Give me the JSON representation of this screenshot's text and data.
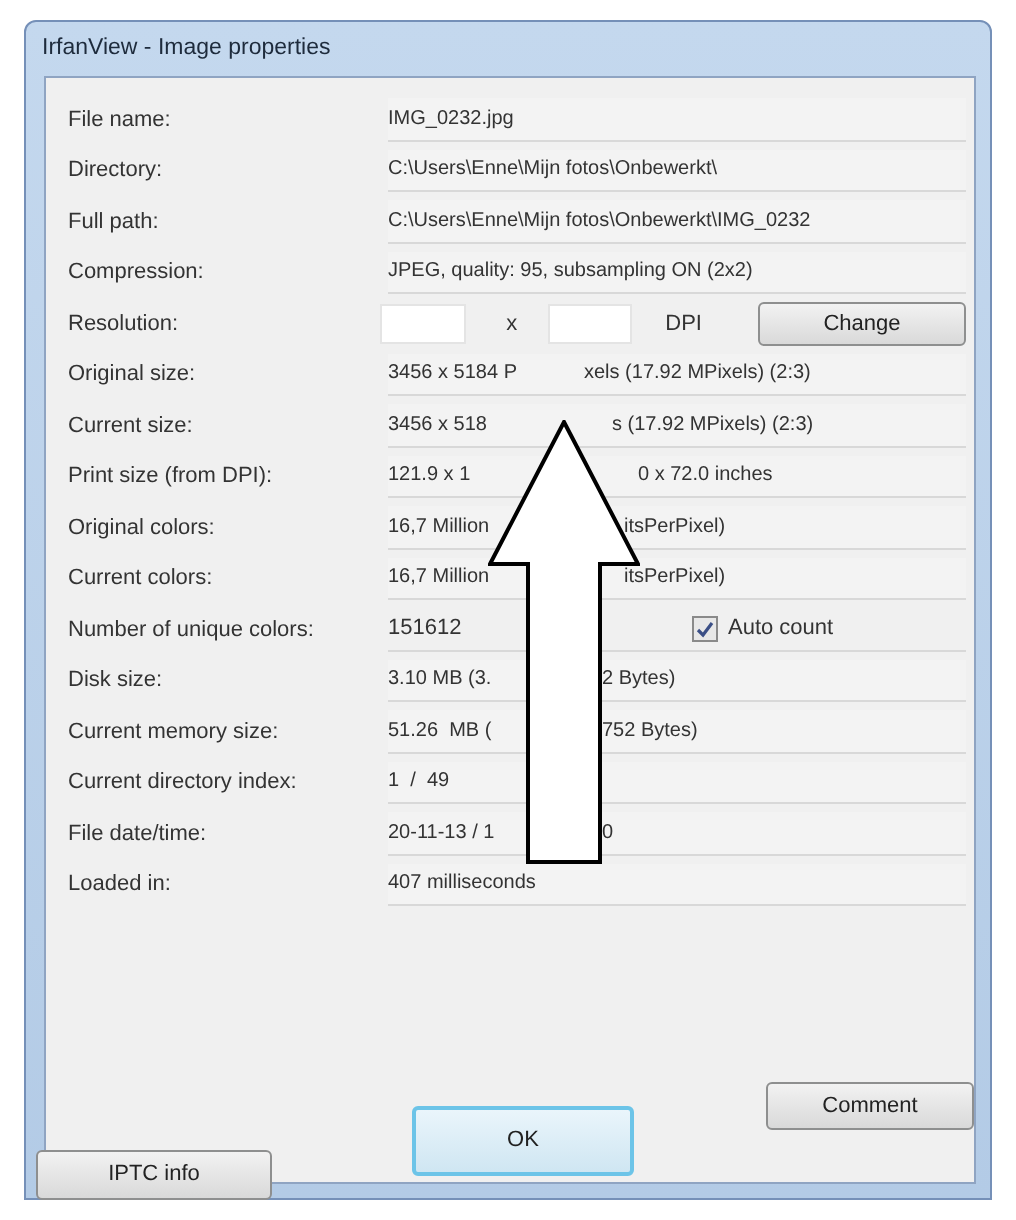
{
  "window": {
    "title": "IrfanView - Image properties"
  },
  "properties": [
    {
      "label": "File name:",
      "kind": "text",
      "value": "IMG_0232.jpg"
    },
    {
      "label": "Directory:",
      "kind": "text",
      "value": "C:\\Users\\Enne\\Mijn fotos\\Onbewerkt\\"
    },
    {
      "label": "Full path:",
      "kind": "text",
      "value": "C:\\Users\\Enne\\Mijn fotos\\Onbewerkt\\IMG_0232"
    },
    {
      "label": "Compression:",
      "kind": "text",
      "value": "JPEG, quality: 95, subsampling ON (2x2)"
    },
    {
      "label": "Resolution:",
      "kind": "resolution",
      "separator": "x",
      "unit": "DPI",
      "button": "Change"
    },
    {
      "label": "Original size:",
      "kind": "text",
      "value": "3456 x 5184 P",
      "value_after": "xels (17.92 MPixels) (2:3)"
    },
    {
      "label": "Current size:",
      "kind": "text",
      "value": "3456 x 518",
      "value_after": "s (17.92 MPixels) (2:3)"
    },
    {
      "label": "Print size (from DPI):",
      "kind": "text",
      "value": "121.9 x 1",
      "value_after": "0 x 72.0 inches"
    },
    {
      "label": "Original colors:",
      "kind": "text",
      "value": "16,7 Million",
      "value_after": "itsPerPixel)"
    },
    {
      "label": "Current colors:",
      "kind": "text",
      "value": "16,7 Million",
      "value_after": "itsPerPixel)"
    },
    {
      "label": "Number of unique colors:",
      "kind": "checkbox",
      "value": "151612",
      "checkbox": {
        "label": "Auto count",
        "checked": true
      }
    },
    {
      "label": "Disk size:",
      "kind": "text",
      "value": "3.10 MB (3.",
      "value_after": "2 Bytes)"
    },
    {
      "label": "Current memory size:",
      "kind": "text",
      "value": "51.26  MB (",
      "value_after": "752 Bytes)"
    },
    {
      "label": "Current directory index:",
      "kind": "text",
      "value": "1  /  49"
    },
    {
      "label": "File date/time:",
      "kind": "text",
      "value": "20-11-13 / 1",
      "value_after": "0"
    },
    {
      "label": "Loaded in:",
      "kind": "text",
      "value": "407 milliseconds"
    }
  ],
  "buttons": {
    "comment": "Comment",
    "ok": "OK",
    "iptc": "IPTC info"
  }
}
